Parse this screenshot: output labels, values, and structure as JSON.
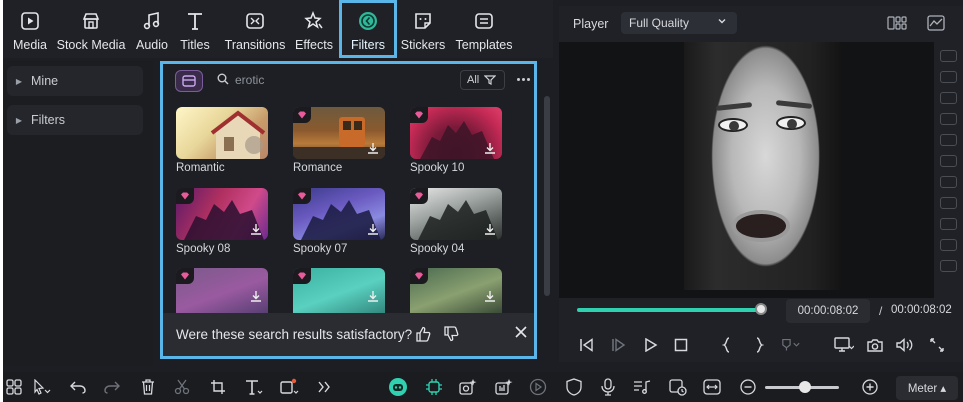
{
  "tabs": [
    {
      "key": "media",
      "label": "Media"
    },
    {
      "key": "stock",
      "label": "Stock Media"
    },
    {
      "key": "audio",
      "label": "Audio"
    },
    {
      "key": "titles",
      "label": "Titles"
    },
    {
      "key": "transitions",
      "label": "Transitions"
    },
    {
      "key": "effects",
      "label": "Effects"
    },
    {
      "key": "filters",
      "label": "Filters",
      "active": true
    },
    {
      "key": "stickers",
      "label": "Stickers"
    },
    {
      "key": "templates",
      "label": "Templates"
    }
  ],
  "sidebar": {
    "items": [
      {
        "label": "Mine"
      },
      {
        "label": "Filters"
      }
    ]
  },
  "search": {
    "value": "erotic",
    "all_label": "All"
  },
  "filters": [
    {
      "name": "Romantic",
      "premium": false
    },
    {
      "name": "Romance",
      "premium": true
    },
    {
      "name": "Spooky 10",
      "premium": true
    },
    {
      "name": "Spooky 08",
      "premium": true
    },
    {
      "name": "Spooky 07",
      "premium": true
    },
    {
      "name": "Spooky 04",
      "premium": true
    },
    {
      "name": "",
      "premium": true
    },
    {
      "name": "",
      "premium": true
    },
    {
      "name": "",
      "premium": true
    }
  ],
  "feedback": {
    "question": "Were these search results satisfactory?"
  },
  "player": {
    "label": "Player",
    "quality": "Full Quality",
    "current_time": "00:00:08:02",
    "separator": "/",
    "total_time": "00:00:08:02",
    "progress": 1.0
  },
  "bottom": {
    "meter_label": "Meter ▴"
  },
  "colors": {
    "accent": "#5ab6e8",
    "progress": "#2fd1b0",
    "premium_gem": "#e85a9a"
  }
}
